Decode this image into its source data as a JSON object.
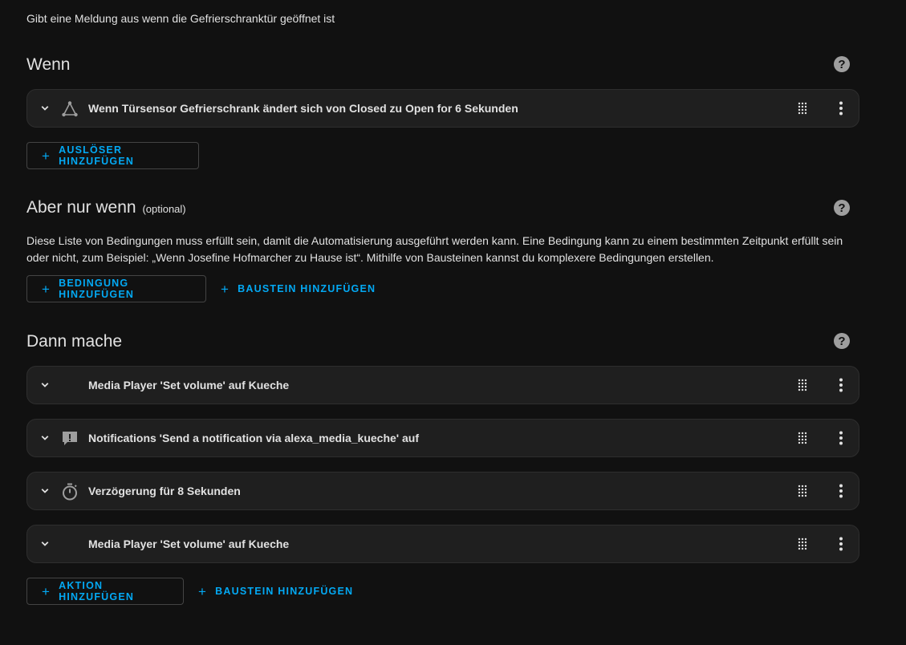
{
  "description": "Gibt eine Meldung aus wenn die Gefrierschranktür geöffnet ist",
  "triggers_section": {
    "title": "Wenn",
    "items": [
      {
        "label": "Wenn Türsensor Gefrierschrank ändert sich von Closed zu Open for 6 Sekunden",
        "icon": "state-change-icon"
      }
    ],
    "add_label": "AUSLÖSER HINZUFÜGEN"
  },
  "conditions_section": {
    "title": "Aber nur wenn",
    "optional": "(optional)",
    "text": "Diese Liste von Bedingungen muss erfüllt sein, damit die Automatisierung ausgeführt werden kann. Eine Bedingung kann zu einem bestimmten Zeitpunkt erfüllt sein oder nicht, zum Beispiel: „Wenn Josefine Hofmarcher zu Hause ist“. Mithilfe von Bausteinen kannst du komplexere Bedingungen erstellen.",
    "add_condition_label": "BEDINGUNG HINZUFÜGEN",
    "add_block_label": "BAUSTEIN HINZUFÜGEN"
  },
  "actions_section": {
    "title": "Dann mache",
    "items": [
      {
        "label": "Media Player 'Set volume' auf Kueche",
        "icon": ""
      },
      {
        "label": "Notifications 'Send a notification via alexa_media_kueche' auf",
        "icon": "notification-icon"
      },
      {
        "label": "Verzögerung für 8 Sekunden",
        "icon": "timer-icon"
      },
      {
        "label": "Media Player 'Set volume' auf Kueche",
        "icon": ""
      }
    ],
    "add_action_label": "AKTION HINZUFÜGEN",
    "add_block_label": "BAUSTEIN HINZUFÜGEN"
  },
  "colors": {
    "accent": "#03a9f4",
    "background": "#111111",
    "card": "#1f1f1f"
  }
}
